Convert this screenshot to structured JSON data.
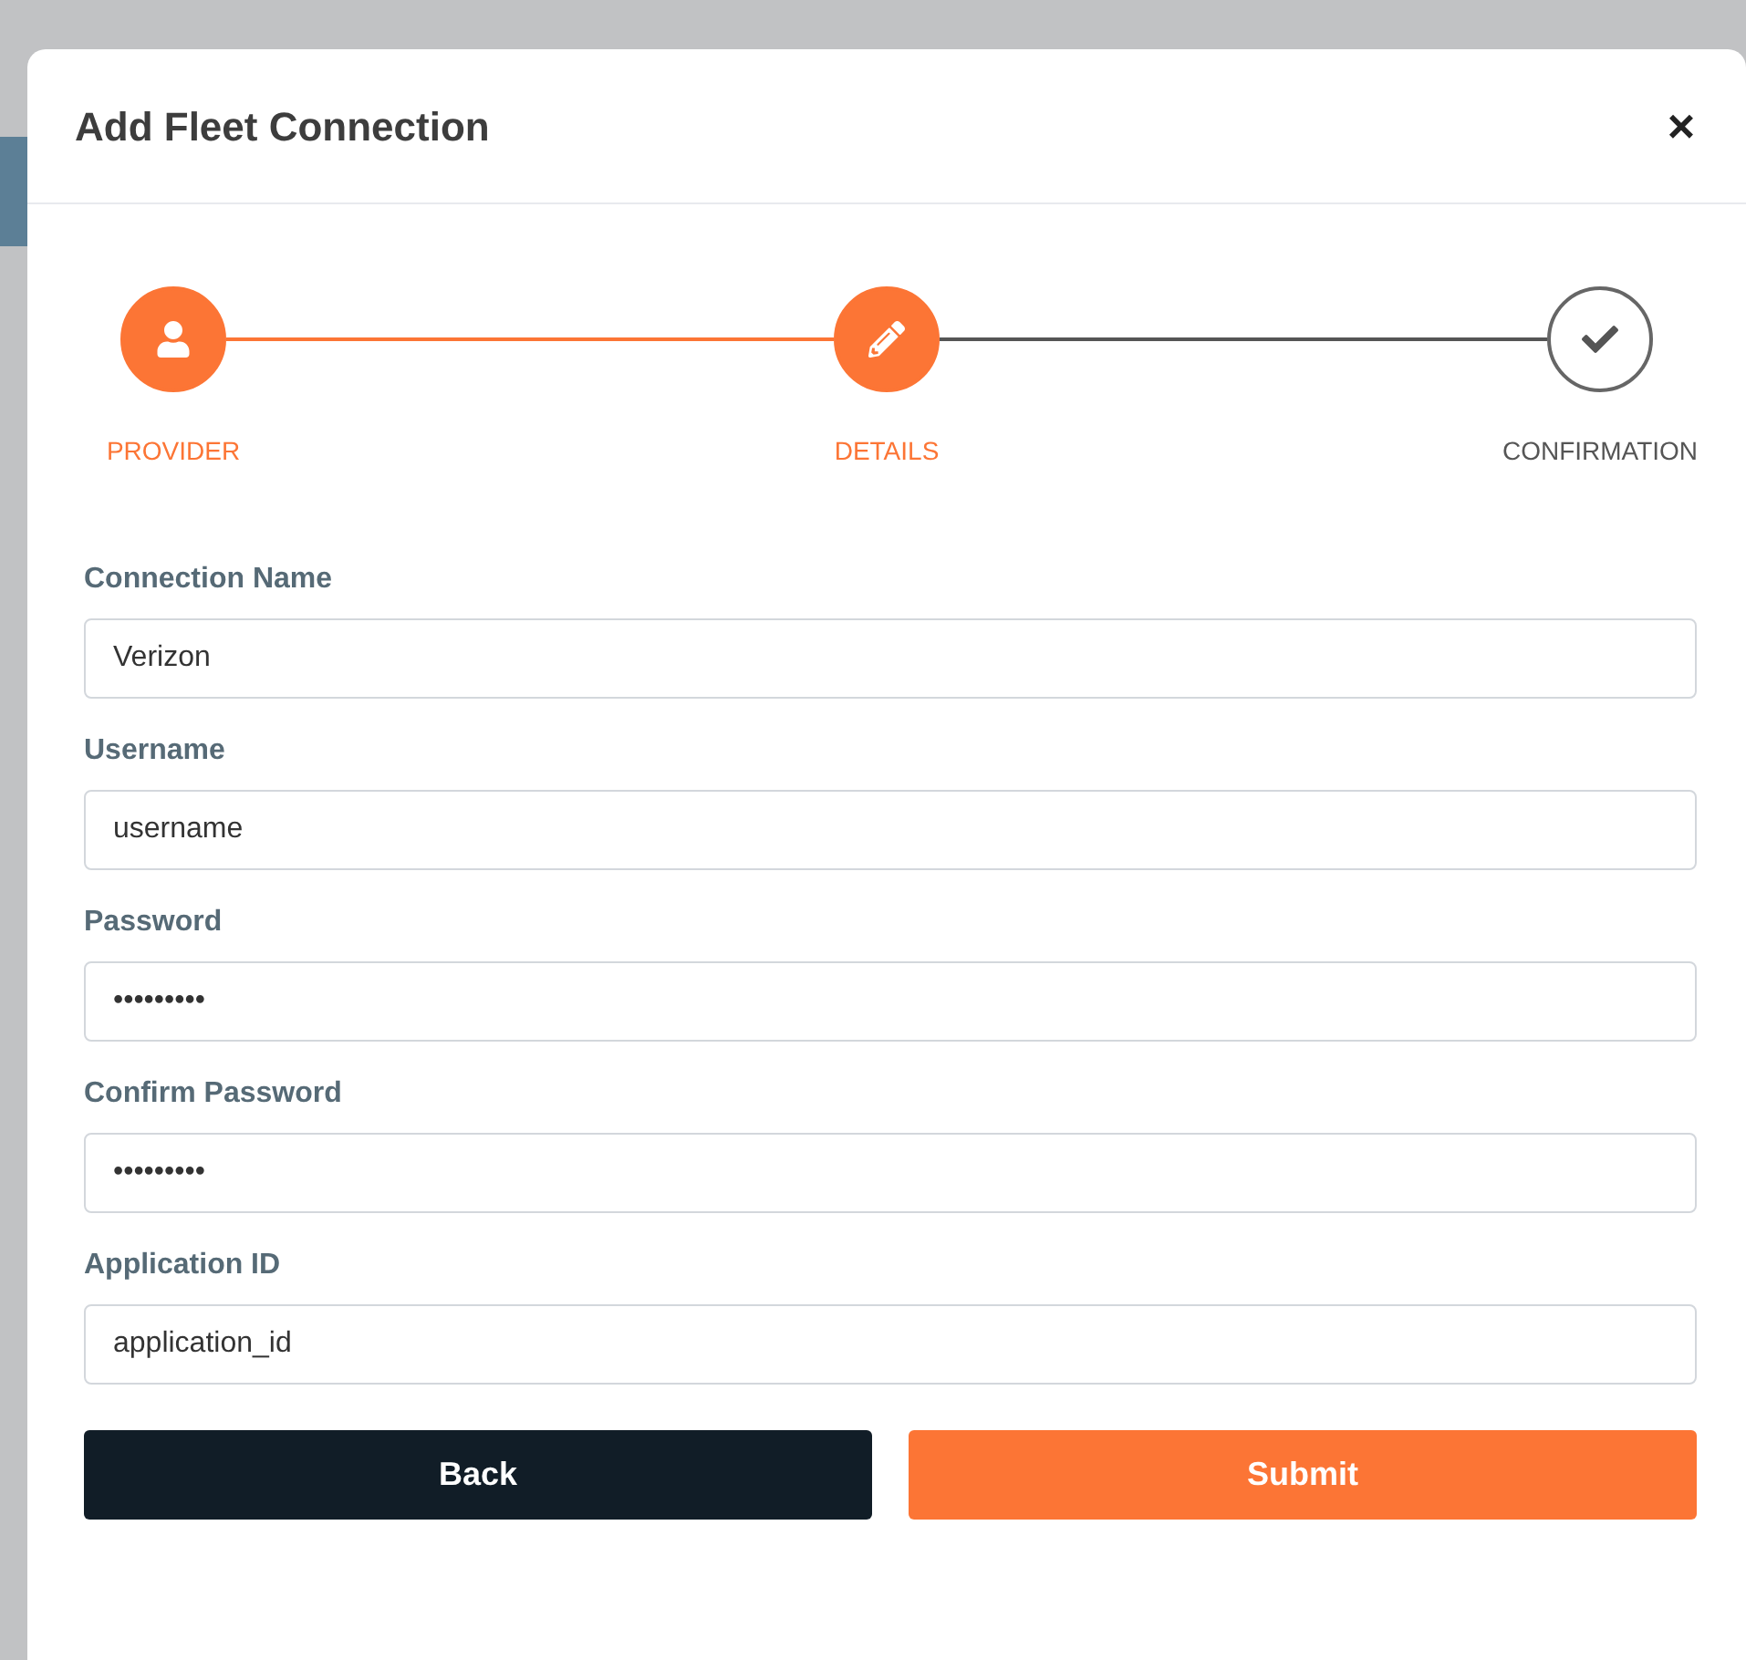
{
  "dialog": {
    "title": "Add Fleet Connection",
    "close": "×"
  },
  "steps": [
    {
      "label": "PROVIDER",
      "active": true
    },
    {
      "label": "DETAILS",
      "active": true
    },
    {
      "label": "CONFIRMATION",
      "active": false
    }
  ],
  "fields": [
    {
      "label": "Connection Name",
      "value": "Verizon"
    },
    {
      "label": "Username",
      "value": "username"
    },
    {
      "label": "Password",
      "value": "•••••••••"
    },
    {
      "label": "Confirm Password",
      "value": "•••••••••"
    },
    {
      "label": "Application ID",
      "value": "application_id"
    }
  ],
  "buttons": [
    {
      "label": "Back",
      "kind": "secondary"
    },
    {
      "label": "Submit",
      "kind": "primary"
    }
  ]
}
